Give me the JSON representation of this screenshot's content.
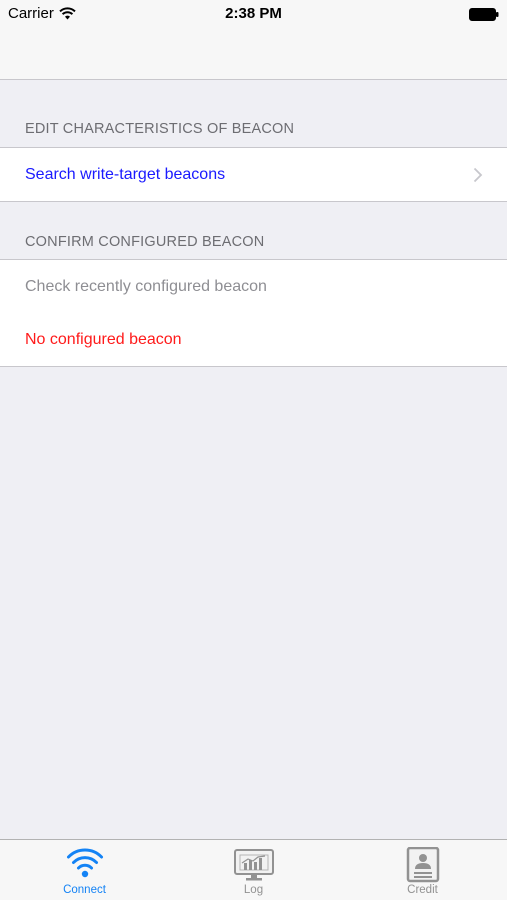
{
  "status_bar": {
    "carrier": "Carrier",
    "time": "2:38 PM"
  },
  "sections": [
    {
      "header": "EDIT CHARACTERISTICS OF BEACON",
      "rows": [
        {
          "label": "Search write-target beacons",
          "style": "link",
          "disclosure": true
        }
      ]
    },
    {
      "header": "CONFIRM CONFIGURED BEACON",
      "rows": [
        {
          "label": "Check recently configured beacon",
          "style": "secondary"
        },
        {
          "label": "No configured beacon",
          "style": "error"
        }
      ]
    }
  ],
  "tabbar": {
    "tabs": [
      {
        "label": "Connect",
        "icon": "wifi-icon",
        "active": true
      },
      {
        "label": "Log",
        "icon": "monitor-chart-icon",
        "active": false
      },
      {
        "label": "Credit",
        "icon": "id-card-icon",
        "active": false
      }
    ]
  },
  "colors": {
    "accent": "#1483f5",
    "link": "#1a1aff",
    "error": "#ff1a1a",
    "background": "#efeff4",
    "secondary_text": "#8e8e93"
  }
}
